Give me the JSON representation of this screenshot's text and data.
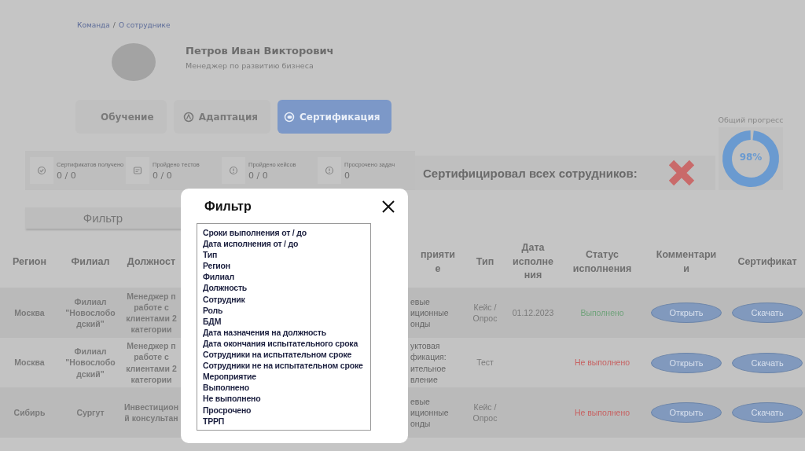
{
  "breadcrumb": [
    "Команда",
    "/",
    "О сотруднике"
  ],
  "profile": {
    "name": "Петров Иван Викторович",
    "position": "Менеджер по развитию бизнеса"
  },
  "tabs": [
    {
      "label": "Обучение",
      "selected": false
    },
    {
      "label": "Адаптация",
      "selected": false
    },
    {
      "label": "Сертификация",
      "selected": true
    }
  ],
  "stats": [
    {
      "label": "Сертификатов получено",
      "value": "0 / 0"
    },
    {
      "label": "Пройдено тестов",
      "value": "0 / 0"
    },
    {
      "label": "Пройдено кейсов",
      "value": "0 / 0"
    },
    {
      "label": "Просрочено задач",
      "value": "0"
    }
  ],
  "certified_all": {
    "label": "Сертифицировал всех сотрудников:",
    "done": false
  },
  "progress": {
    "title": "Общий прогресс",
    "level": 0.98,
    "reading": "98%"
  },
  "filter_button": "Фильтр",
  "table": {
    "columns": [
      "Регион",
      "Филиал",
      "Должност",
      "",
      "прияти\nе",
      "Тип",
      "Дата\nисполне\nния",
      "Статус\nисполнения",
      "Комментари\nи",
      "Сертификат"
    ],
    "rows": [
      {
        "cells": [
          "Москва",
          "Филиал\n\"Новослобо\nдский\"",
          "Менеджер п\nработе с\nклиентами 2\nкатегории",
          "",
          "евые\nиционные\nонды",
          "Кейс /\nОпрос",
          "01.12.2023"
        ],
        "status": "Выполнено",
        "done": true,
        "comment": "Открыть",
        "certificate": "Скачать"
      },
      {
        "cells": [
          "Москва",
          "Филиал\n\"Новослобо\nдский\"",
          "Менеджер п\nработе с\nклиентами 2\nкатегории",
          "",
          "уктовая\nфикация:\nительное\nвление",
          "Тест",
          ""
        ],
        "status": "Не выполнено",
        "done": false,
        "comment": "Открыть",
        "certificate": "Скачать"
      },
      {
        "cells": [
          "Сибирь",
          "Сургут",
          "Инвестицион\nй консультан",
          "",
          "евые\nиционные\nонды",
          "Кейс /\nОпрос",
          ""
        ],
        "status": "Не выполнено",
        "done": false,
        "comment": "Открыть",
        "certificate": "Скачать"
      }
    ]
  },
  "filter_dialog": {
    "title": "Фильтр",
    "options": [
      "Сроки выполнения от / до",
      "Дата исполнения от / до",
      "Тип",
      "Регион",
      "Филиал",
      "Должность",
      "Сотрудник",
      "Роль",
      "БДМ",
      "Дата назначения на должность",
      "Дата окончания испытательного срока",
      "Сотрудники на испытательном сроке",
      "Сотрудники не на испытательном сроке",
      "Мероприятие",
      "Выполнено",
      "Не выполнено",
      "Просрочено",
      "ТРРП"
    ]
  }
}
